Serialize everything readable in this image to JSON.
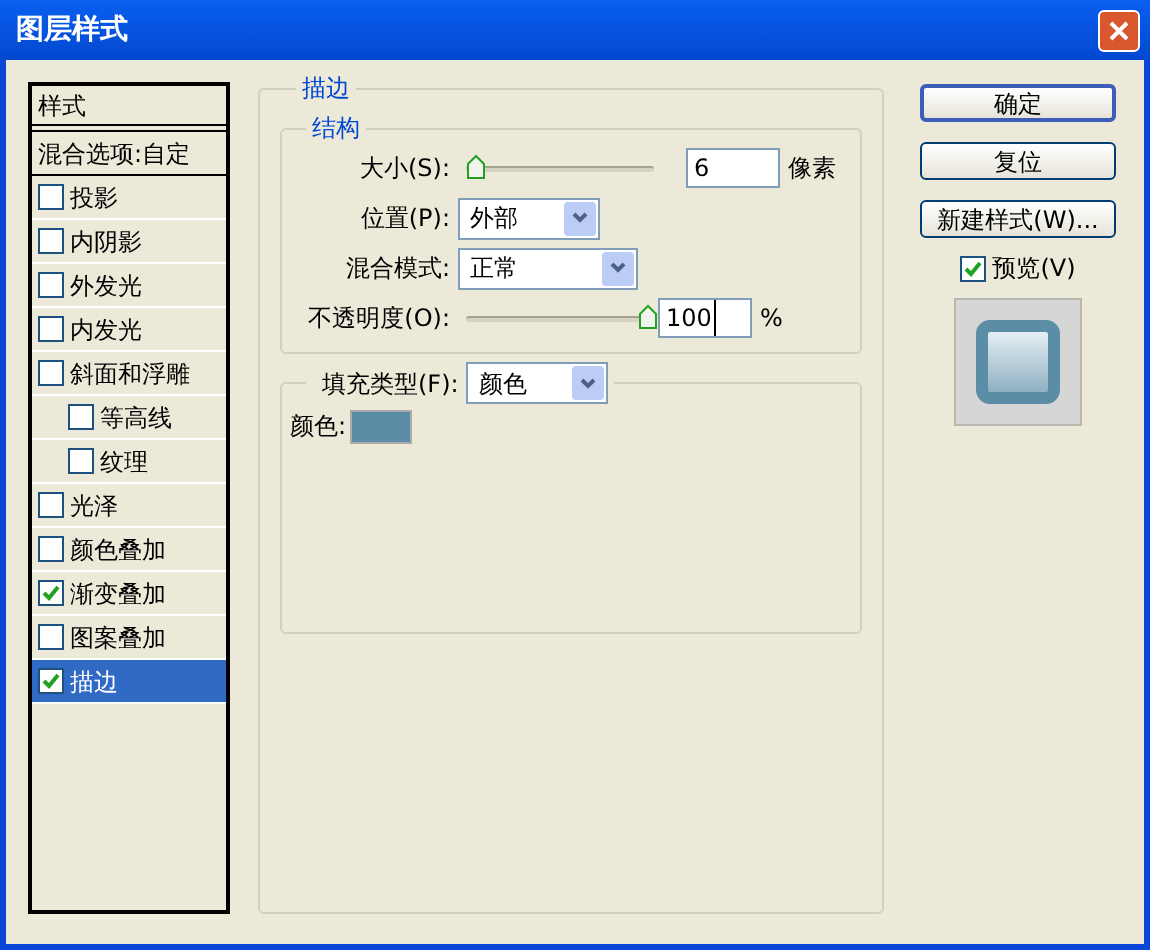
{
  "window": {
    "title": "图层样式"
  },
  "styles_list": {
    "header": "样式",
    "blend_options": "混合选项:自定",
    "items": [
      {
        "label": "投影",
        "checked": false,
        "selected": false
      },
      {
        "label": "内阴影",
        "checked": false,
        "selected": false
      },
      {
        "label": "外发光",
        "checked": false,
        "selected": false
      },
      {
        "label": "内发光",
        "checked": false,
        "selected": false
      },
      {
        "label": "斜面和浮雕",
        "checked": false,
        "selected": false,
        "children": [
          {
            "label": "等高线",
            "checked": false,
            "selected": false
          },
          {
            "label": "纹理",
            "checked": false,
            "selected": false
          }
        ]
      },
      {
        "label": "光泽",
        "checked": false,
        "selected": false
      },
      {
        "label": "颜色叠加",
        "checked": false,
        "selected": false
      },
      {
        "label": "渐变叠加",
        "checked": true,
        "selected": false
      },
      {
        "label": "图案叠加",
        "checked": false,
        "selected": false
      },
      {
        "label": "描边",
        "checked": true,
        "selected": true
      }
    ]
  },
  "stroke": {
    "title": "描边",
    "structure": {
      "title": "结构",
      "size": {
        "label": "大小(S):",
        "level": 0.02,
        "value": "6",
        "unit": "像素"
      },
      "position": {
        "label": "位置(P):",
        "value": "外部"
      },
      "blend_mode": {
        "label": "混合模式:",
        "value": "正常"
      },
      "opacity": {
        "label": "不透明度(O):",
        "level": 1,
        "value": "100",
        "unit": "%"
      }
    },
    "fill": {
      "type_label": "填充类型(F):",
      "type_value": "颜色",
      "color_label": "颜色:",
      "color": "#5b8ea6"
    }
  },
  "buttons": [
    {
      "label": "确定",
      "default": true
    },
    {
      "label": "复位",
      "default": false
    },
    {
      "label": "新建样式(W)...",
      "default": false
    }
  ],
  "preview": {
    "label": "预览(V)",
    "checked": true
  }
}
